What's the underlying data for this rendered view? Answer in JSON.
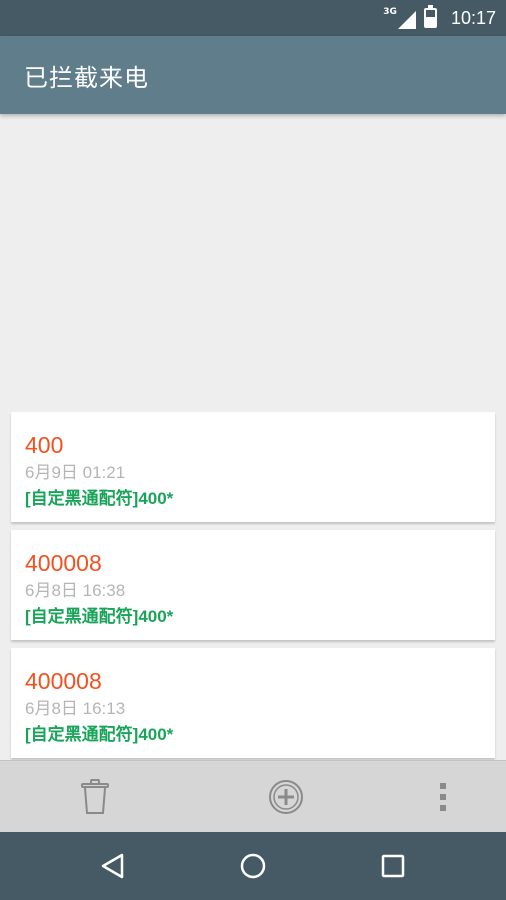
{
  "status_bar": {
    "network": "3G",
    "time": "10:17",
    "icons": [
      "signal-icon",
      "battery-charging-icon"
    ]
  },
  "app_bar": {
    "title": "已拦截来电"
  },
  "calls": [
    {
      "number": "400",
      "date": "6月9日 01:21",
      "rule": "[自定黑通配符]400*"
    },
    {
      "number": "400008",
      "date": "6月8日 16:38",
      "rule": "[自定黑通配符]400*"
    },
    {
      "number": "400008",
      "date": "6月8日 16:13",
      "rule": "[自定黑通配符]400*"
    }
  ],
  "bottom_bar": {
    "icons": [
      "trash-icon",
      "add-circle-icon",
      "more-vert-icon"
    ]
  },
  "nav_bar": {
    "icons": [
      "back-icon",
      "home-icon",
      "recents-icon"
    ]
  },
  "colors": {
    "status_bar": "#455a64",
    "app_bar": "#607d8b",
    "number": "#f4511e",
    "date": "#b5b5b5",
    "rule": "#1aa45a",
    "background": "#eeeeee",
    "bottom_bar": "#d6d6d6"
  }
}
